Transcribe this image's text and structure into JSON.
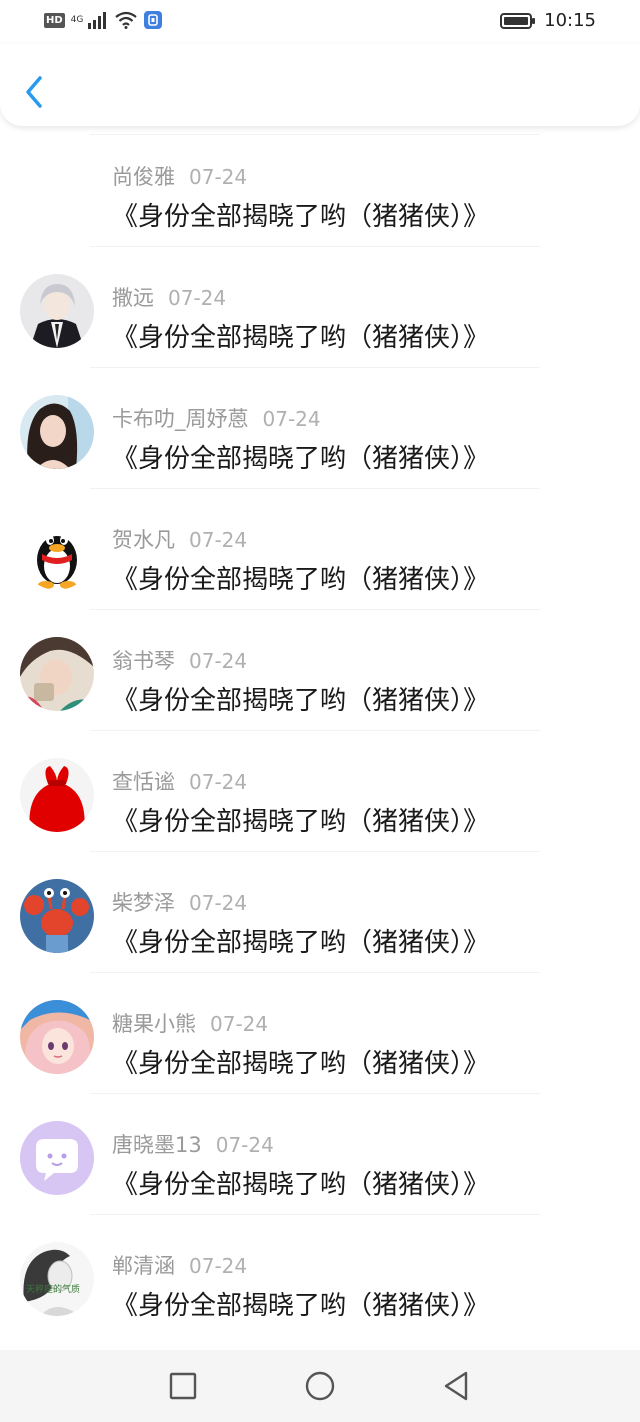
{
  "status_bar": {
    "hd_badge": "HD",
    "network": "4G",
    "time": "10:15",
    "icons": [
      "hd-icon",
      "signal-icon",
      "wifi-icon",
      "shield-app-icon",
      "battery-icon"
    ]
  },
  "nav": {
    "back_icon": "chevron-left-icon",
    "accent": "#2a9af0"
  },
  "comments": [
    {
      "name": "尚俊雅",
      "date": "07-24",
      "text": "《身份全部揭晓了哟（猪猪侠）》",
      "avatar": "none"
    },
    {
      "name": "撒远",
      "date": "07-24",
      "text": "《身份全部揭晓了哟（猪猪侠）》",
      "avatar": "anime-suit-avatar"
    },
    {
      "name": "卡布叻_周妤蒽",
      "date": "07-24",
      "text": "《身份全部揭晓了哟（猪猪侠）》",
      "avatar": "girl-photo-avatar"
    },
    {
      "name": "贺水凡",
      "date": "07-24",
      "text": "《身份全部揭晓了哟（猪猪侠）》",
      "avatar": "qq-penguin-avatar"
    },
    {
      "name": "翁书琴",
      "date": "07-24",
      "text": "《身份全部揭晓了哟（猪猪侠）》",
      "avatar": "girl-selfie-avatar"
    },
    {
      "name": "查恬谧",
      "date": "07-24",
      "text": "《身份全部揭晓了哟（猪猪侠）》",
      "avatar": "red-bag-avatar"
    },
    {
      "name": "柴梦泽",
      "date": "07-24",
      "text": "《身份全部揭晓了哟（猪猪侠）》",
      "avatar": "crab-cartoon-avatar"
    },
    {
      "name": "糖果小熊",
      "date": "07-24",
      "text": "《身份全部揭晓了哟（猪猪侠）》",
      "avatar": "anime-girl-avatar"
    },
    {
      "name": "唐晓墨13",
      "date": "07-24",
      "text": "《身份全部揭晓了哟（猪猪侠）》",
      "avatar": "chat-bubble-avatar"
    },
    {
      "name": "郸清涵",
      "date": "07-24",
      "text": "《身份全部揭晓了哟（猪猪侠）》",
      "avatar": "sketch-girl-avatar",
      "avatar_text": "天秤座的气质"
    }
  ],
  "system_nav": {
    "icons": [
      "recent-apps-icon",
      "home-icon",
      "back-triangle-icon"
    ],
    "background": "#f5f5f5"
  }
}
